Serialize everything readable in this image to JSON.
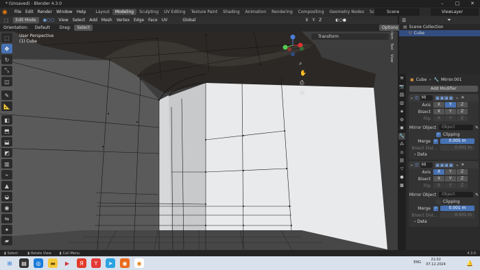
{
  "window": {
    "title": "* (Unsaved) - Blender 4.3.0",
    "controls": [
      "–",
      "□",
      "✕"
    ]
  },
  "menu": {
    "items": [
      "File",
      "Edit",
      "Render",
      "Window",
      "Help"
    ],
    "workspaces": [
      "Layout",
      "Modeling",
      "Sculpting",
      "UV Editing",
      "Texture Paint",
      "Shading",
      "Animation",
      "Rendering",
      "Compositing",
      "Geometry Nodes",
      "Scripting"
    ],
    "active_workspace": "Modeling",
    "scene": "Scene",
    "view_layer": "ViewLayer"
  },
  "viewport_header": {
    "mode": "Edit Mode",
    "menus": [
      "View",
      "Select",
      "Add",
      "Mesh",
      "Vertex",
      "Edge",
      "Face",
      "UV"
    ],
    "transform_orientation": "Global",
    "axes": [
      "X",
      "Y",
      "Z"
    ],
    "options": "Options"
  },
  "viewport_header2": {
    "orientation_label": "Orientation:",
    "orientation_value": "Default",
    "drag_label": "Drag:",
    "drag_value": "Select Box"
  },
  "viewport": {
    "view_name": "User Perspective",
    "object_info": "(1) Cube",
    "transform_panel": "Transform",
    "side_tabs": [
      "Item",
      "Tool",
      "View"
    ]
  },
  "outliner": {
    "collection": "Scene Collection",
    "object": "Cube"
  },
  "properties": {
    "breadcrumb_object": "Cube",
    "breadcrumb_modifier": "Mirror.001",
    "add_modifier": "Add Modifier",
    "modifiers": [
      {
        "name": "Mi",
        "axis_label": "Axis",
        "bisect_label": "Bisect",
        "flip_label": "Flip",
        "mirror_object_label": "Mirror Object",
        "mirror_object_placeholder": "Object",
        "clipping_label": "Clipping",
        "merge_label": "Merge",
        "merge_value": "0.005 m",
        "bisect_dist_label": "Bisect Dist...",
        "bisect_dist_value": "0.001 m",
        "data_label": "Data"
      },
      {
        "name": "Mi",
        "axis_label": "Axis",
        "bisect_label": "Bisect",
        "flip_label": "Flip",
        "mirror_object_label": "Mirror Object",
        "mirror_object_placeholder": "Object",
        "clipping_label": "Clipping",
        "merge_label": "Merge",
        "merge_value": "0.001 m",
        "bisect_dist_label": "Bisect Dist...",
        "bisect_dist_value": "0.001 m",
        "data_label": "Data"
      }
    ]
  },
  "statusbar": {
    "items": [
      "Select",
      "Rotate View",
      "Call Menu"
    ],
    "version": "4.3.0"
  },
  "taskbar": {
    "lang": "ENG",
    "time": "21:02",
    "date": "07.12.2024"
  }
}
